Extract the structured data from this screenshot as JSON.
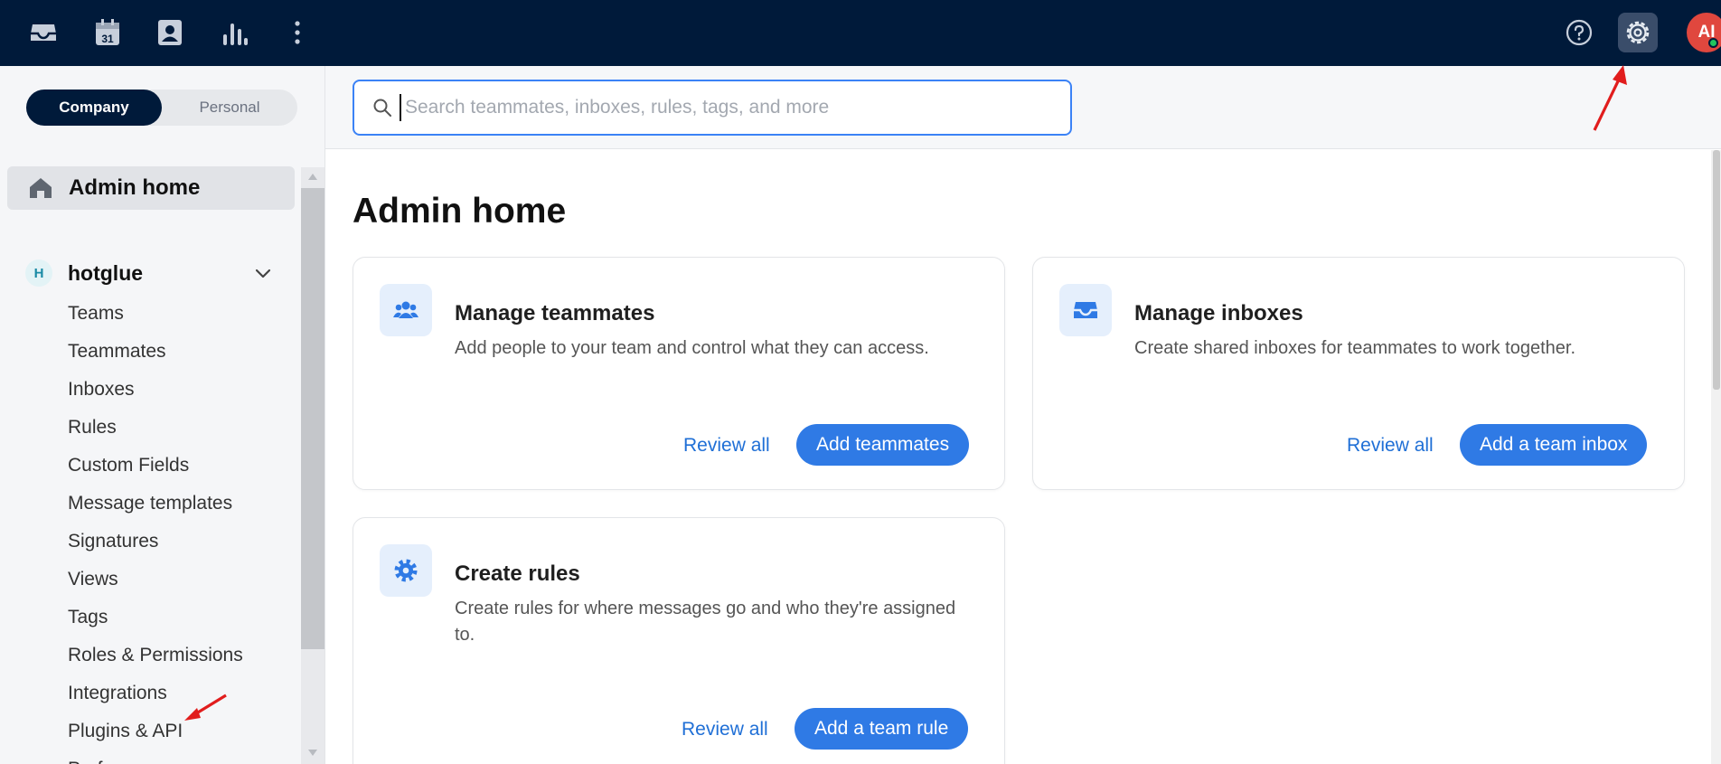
{
  "topbar": {
    "icons": [
      "inbox-icon",
      "calendar-icon",
      "contacts-icon",
      "analytics-icon",
      "more-vertical-icon",
      "help-icon",
      "gear-icon"
    ],
    "calendar_day": "31",
    "avatar_initials": "AI",
    "background": "#001a3a"
  },
  "sidebar": {
    "scope_company": "Company",
    "scope_personal": "Personal",
    "home_label": "Admin home",
    "org_badge": "H",
    "org_name": "hotglue",
    "items": [
      "Teams",
      "Teammates",
      "Inboxes",
      "Rules",
      "Custom Fields",
      "Message templates",
      "Signatures",
      "Views",
      "Tags",
      "Roles & Permissions",
      "Integrations",
      "Plugins & API",
      "Preferences"
    ]
  },
  "search": {
    "placeholder": "Search teammates, inboxes, rules, tags, and more",
    "value": ""
  },
  "main": {
    "title": "Admin home",
    "cards": [
      {
        "icon": "people-icon",
        "title": "Manage teammates",
        "description": "Add people to your team and control what they can access.",
        "secondary": "Review all",
        "primary": "Add teammates"
      },
      {
        "icon": "inbox-icon",
        "title": "Manage inboxes",
        "description": "Create shared inboxes for teammates to work together.",
        "secondary": "Review all",
        "primary": "Add a team inbox"
      },
      {
        "icon": "gear-icon",
        "title": "Create rules",
        "description": "Create rules for where messages go and who they're assigned to.",
        "secondary": "Review all",
        "primary": "Add a team rule"
      }
    ]
  },
  "colors": {
    "accent": "#2f7ae5",
    "link": "#1f6fd6",
    "annotation_arrow": "#e11d1d"
  }
}
